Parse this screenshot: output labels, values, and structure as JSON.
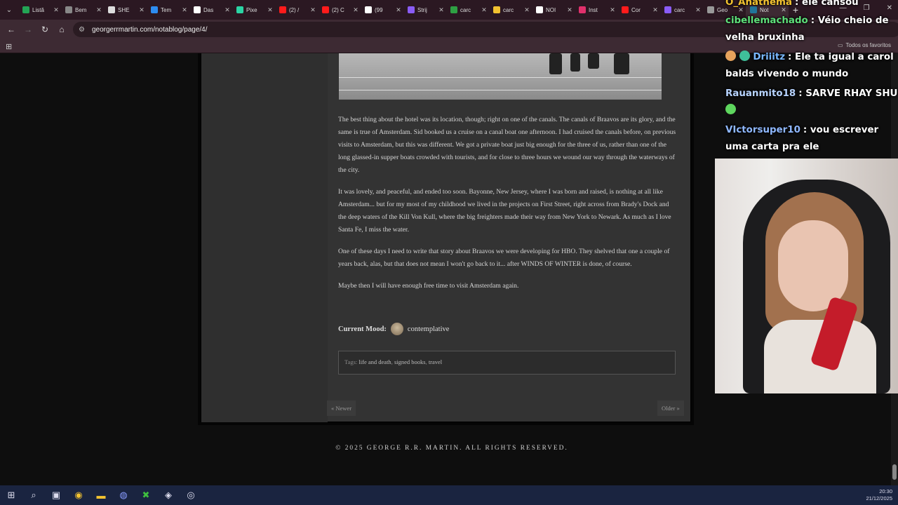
{
  "browser": {
    "tabs": [
      {
        "label": "Listă",
        "color": "#23a455"
      },
      {
        "label": "Bem",
        "color": "#888888"
      },
      {
        "label": "SHE",
        "color": "#dddddd"
      },
      {
        "label": "Tem",
        "color": "#2d8cf0"
      },
      {
        "label": "Das",
        "color": "#ffffff"
      },
      {
        "label": "Pixe",
        "color": "#2bd4a4"
      },
      {
        "label": "(2) /",
        "color": "#ff1b1b"
      },
      {
        "label": "(2) C",
        "color": "#ff1b1b"
      },
      {
        "label": "(99",
        "color": "#ffffff"
      },
      {
        "label": "Strij",
        "color": "#8a5cf6"
      },
      {
        "label": "carc",
        "color": "#2ea043"
      },
      {
        "label": "carc",
        "color": "#f2c230"
      },
      {
        "label": "NOI",
        "color": "#ffffff"
      },
      {
        "label": "Inst",
        "color": "#e1306c"
      },
      {
        "label": "Cor",
        "color": "#ff1b1b"
      },
      {
        "label": "carc",
        "color": "#8a5cf6"
      },
      {
        "label": "Geo",
        "color": "#999999"
      },
      {
        "label": "Not",
        "color": "#21759b"
      }
    ],
    "url": "georgerrmartin.com/notablog/page/4/",
    "all_favorites": "Todos os favoritos"
  },
  "post": {
    "paragraphs": [
      "The best thing about the hotel was its location, though; right on one of the canals.   The canals of Braavos are its glory, and the same is true of Amsterdam.   Sid booked us a cruise on a canal boat one afternoon.   I had cruised the canals before, on previous visits to Amsterdam, but this was different.   We got a private boat just big enough for the three of us, rather than one of the long glassed-in supper boats crowded with tourists, and for close to three hours we wound our way through the waterways of the city.",
      "It was lovely, and peaceful, and ended too soon.   Bayonne, New Jersey, where I was born and raised, is nothing at all like Amsterdam... but for my most of my childhood we lived in the projects on First Street, right across from Brady's Dock and the deep waters of the Kill Von Kull, where the big freighters made their way from New York to Newark.   As much as I love Santa Fe,  I miss the water.",
      "One of these days I need to write that story about Braavos we were developing for HBO.   They shelved that one a couple of years back, alas, but that does not mean I won't go back to it... after WINDS OF WINTER is done, of course.",
      "Maybe then I will have enough free time to visit Amsterdam again."
    ],
    "mood_label": "Current Mood:",
    "mood_value": "contemplative",
    "tags_label": "Tags:",
    "tags": [
      "life and death",
      "signed books",
      "travel"
    ],
    "newer": "« Newer",
    "older": "Older »",
    "footer": "© 2025 GEORGE R.R. MARTIN. ALL RIGHTS RESERVED."
  },
  "chat": [
    {
      "user": "O_Anathema",
      "user_color": "#f2c230",
      "text": ": ele cansou"
    },
    {
      "user": "cibellemachado",
      "user_color": "#5ee07a",
      "text": ": Véio cheio de velha bruxinha"
    },
    {
      "user": "Driiitz",
      "user_color": "#7ab8ff",
      "text": ": Ele ta igual a carol balds vivendo o mundo"
    },
    {
      "user": "Rauanmito18",
      "user_color": "#b8d4ff",
      "text": ": SARVE RHAY SHU"
    },
    {
      "user": "VIctorsuper10",
      "user_color": "#8fb8ff",
      "text": ": vou escrever uma carta pra ele"
    }
  ],
  "taskbar": {
    "time": "20:30",
    "date": "21/12/2025"
  }
}
